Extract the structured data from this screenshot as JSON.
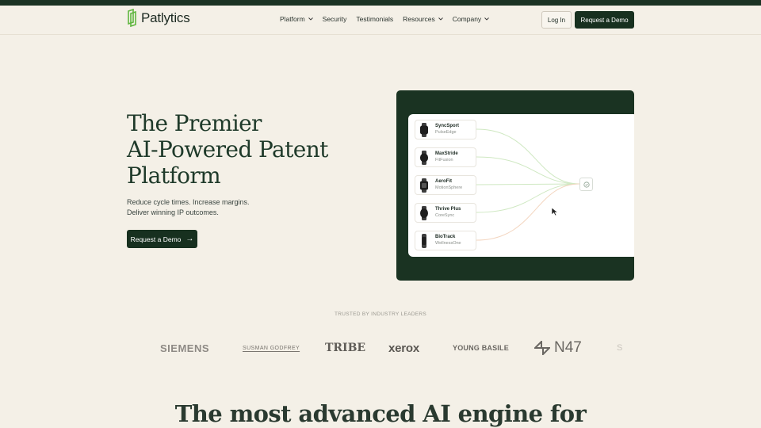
{
  "brand": {
    "name": "Patlytics",
    "accent": "#6cc04a",
    "dark": "#17301f"
  },
  "nav": {
    "items": [
      {
        "label": "Platform",
        "dropdown": true
      },
      {
        "label": "Security",
        "dropdown": false
      },
      {
        "label": "Testimonials",
        "dropdown": false
      },
      {
        "label": "Resources",
        "dropdown": true
      },
      {
        "label": "Company",
        "dropdown": true
      }
    ],
    "login_label": "Log In",
    "demo_label": "Request a Demo"
  },
  "hero": {
    "title_lines": [
      "The Premier",
      "AI-Powered Patent",
      "Platform"
    ],
    "subtitle_lines": [
      "Reduce cycle times. Increase margins.",
      "Deliver winning IP outcomes."
    ],
    "cta_label": "Request a Demo"
  },
  "visual": {
    "products": [
      {
        "name": "SyncSport",
        "brand": "PulseEdge"
      },
      {
        "name": "MaxStride",
        "brand": "FitFusion"
      },
      {
        "name": "AeroFit",
        "brand": "MotionSphere"
      },
      {
        "name": "Thrive Plus",
        "brand": "CoreSync"
      },
      {
        "name": "BioTrack",
        "brand": "WellnessOne"
      }
    ],
    "hub_icon": "check-circle-icon"
  },
  "trusted": {
    "label": "TRUSTED BY INDUSTRY LEADERS",
    "logos": [
      "SIEMENS",
      "SUSMAN GODFREY",
      "TRIBE",
      "xerox",
      "YOUNG BASILE",
      "N47",
      "S"
    ]
  },
  "section2": {
    "title": "The most advanced AI engine for"
  }
}
